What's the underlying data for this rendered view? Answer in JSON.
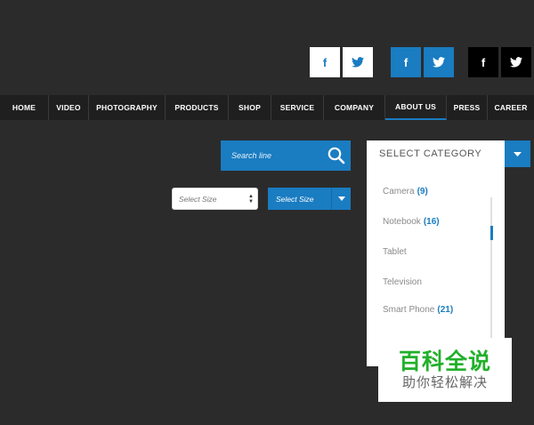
{
  "social": {
    "light": [
      {
        "icon": "facebook-icon",
        "glyph": "f"
      },
      {
        "icon": "twitter-icon",
        "glyph": ""
      }
    ],
    "blue": [
      {
        "icon": "facebook-icon",
        "glyph": "f"
      },
      {
        "icon": "twitter-icon",
        "glyph": ""
      }
    ],
    "dark": [
      {
        "icon": "facebook-icon",
        "glyph": "f"
      },
      {
        "icon": "twitter-icon",
        "glyph": ""
      }
    ],
    "colors": {
      "brand_blue": "#1a7cc1",
      "white": "#ffffff",
      "black": "#000000"
    }
  },
  "nav": {
    "items": [
      "HOME",
      "VIDEO",
      "PHOTOGRAPHY",
      "PRODUCTS",
      "SHOP",
      "SERVICE",
      "COMPANY",
      "ABOUT US",
      "PRESS",
      "CAREER"
    ],
    "active": "ABOUT US"
  },
  "search": {
    "placeholder": "Search line",
    "icon": "search-icon"
  },
  "size_select_light": {
    "label": "Select Size"
  },
  "size_select_blue": {
    "label": "Select Size"
  },
  "category": {
    "label": "SELECT CATEGORY",
    "items": [
      {
        "name": "Camera",
        "count": "(9)"
      },
      {
        "name": "Notebook",
        "count": "(16)"
      },
      {
        "name": "Tablet",
        "count": ""
      },
      {
        "name": "Television",
        "count": ""
      },
      {
        "name": "Smart Phone",
        "count": "(21)"
      }
    ]
  },
  "watermark": {
    "title": "百科全说",
    "subtitle": "助你轻松解决"
  }
}
